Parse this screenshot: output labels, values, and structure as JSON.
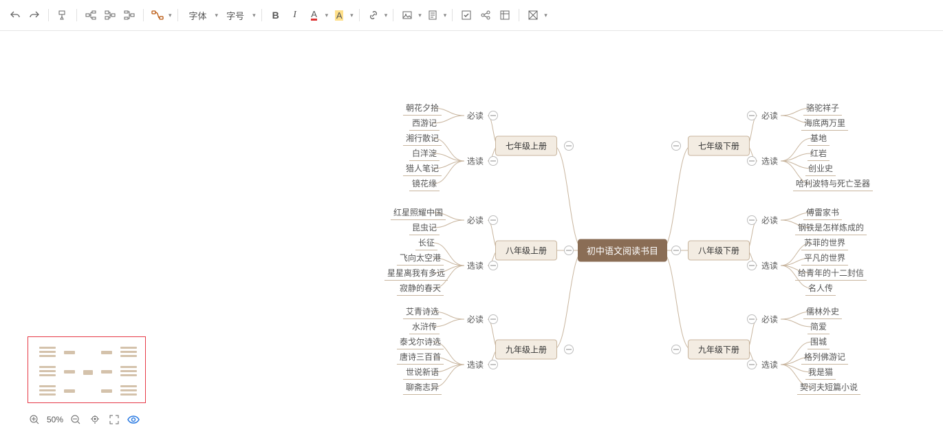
{
  "toolbar": {
    "font_label": "字体",
    "size_label": "字号"
  },
  "zoom": {
    "pct": "50%"
  },
  "root": "初中语文阅读书目",
  "grades": {
    "g7u": "七年级上册",
    "g7d": "七年级下册",
    "g8u": "八年级上册",
    "g8d": "八年级下册",
    "g9u": "九年级上册",
    "g9d": "九年级下册"
  },
  "cat": {
    "must": "必读",
    "opt": "选读"
  },
  "leaves": {
    "g7u_m": [
      "朝花夕拾",
      "西游记"
    ],
    "g7u_o": [
      "湘行散记",
      "白洋淀",
      "猎人笔记",
      "镜花缘"
    ],
    "g7d_m": [
      "骆驼祥子",
      "海底两万里"
    ],
    "g7d_o": [
      "基地",
      "红岩",
      "创业史",
      "哈利波特与死亡圣器"
    ],
    "g8u_m": [
      "红星照耀中国",
      "昆虫记"
    ],
    "g8u_o": [
      "长征",
      "飞向太空港",
      "星星离我有多远",
      "寂静的春天"
    ],
    "g8d_m": [
      "傅雷家书",
      "钢铁是怎样炼成的"
    ],
    "g8d_o": [
      "苏菲的世界",
      "平凡的世界",
      "给青年的十二封信",
      "名人传"
    ],
    "g9u_m": [
      "艾青诗选",
      "水浒传"
    ],
    "g9u_o": [
      "泰戈尔诗选",
      "唐诗三百首",
      "世说新语",
      "聊斋志异"
    ],
    "g9d_m": [
      "儒林外史",
      "简爱"
    ],
    "g9d_o": [
      "围城",
      "格列佛游记",
      "我是猫",
      "契诃夫短篇小说"
    ]
  }
}
